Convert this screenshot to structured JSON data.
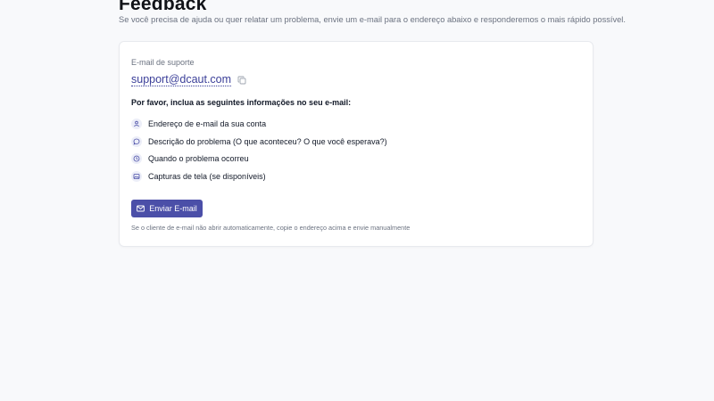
{
  "header": {
    "title": "Feedback",
    "subtitle": "Se você precisa de ajuda ou quer relatar um problema, envie um e-mail para o endereço abaixo e responderemos o mais rápido possível."
  },
  "support": {
    "label": "E-mail de suporte",
    "email": "support@dcaut.com",
    "copy_icon": "copy-icon"
  },
  "info": {
    "heading": "Por favor, inclua as seguintes informações no seu e-mail:",
    "items": [
      {
        "icon": "user-icon",
        "label": "Endereço de e-mail da sua conta"
      },
      {
        "icon": "message-icon",
        "label": "Descrição do problema (O que aconteceu? O que você esperava?)"
      },
      {
        "icon": "clock-icon",
        "label": "Quando o problema ocorreu"
      },
      {
        "icon": "image-icon",
        "label": "Capturas de tela (se disponíveis)"
      }
    ]
  },
  "actions": {
    "send_label": "Enviar E-mail",
    "send_icon": "mail-icon",
    "hint": "Se o cliente de e-mail não abrir automaticamente, copie o endereço acima e envie manualmente"
  },
  "colors": {
    "accent": "#4b4fa8",
    "link": "#3b3f99",
    "background": "#f8f9fb",
    "muted_text": "#6b7280"
  }
}
